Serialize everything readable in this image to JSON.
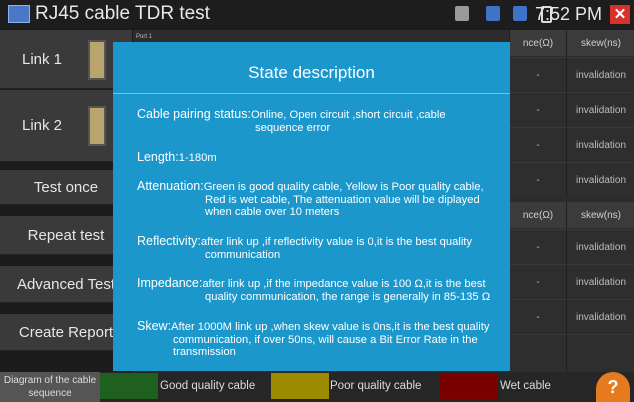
{
  "statusbar": {
    "title": "RJ45 cable TDR test",
    "time": "7:52 PM",
    "close_glyph": "✕"
  },
  "sidebar": {
    "items": [
      {
        "label": "Link 1"
      },
      {
        "label": "Link 2"
      },
      {
        "label": "Test once"
      },
      {
        "label": "Repeat test"
      },
      {
        "label": "Advanced Test"
      },
      {
        "label": "Create Report"
      }
    ]
  },
  "table": {
    "port_label": "Port 1",
    "headers": [
      "nce(Ω)",
      "skew(ns)"
    ],
    "rows": [
      {
        "impedance": "-",
        "skew": "invalidation"
      },
      {
        "impedance": "-",
        "skew": "invalidation"
      },
      {
        "impedance": "-",
        "skew": "invalidation"
      },
      {
        "impedance": "-",
        "skew": "invalidation"
      },
      {
        "impedance": "-",
        "skew": "invalidation"
      },
      {
        "impedance": "-",
        "skew": "invalidation"
      },
      {
        "impedance": "-",
        "skew": "invalidation"
      }
    ]
  },
  "dialog": {
    "title": "State description",
    "items": [
      {
        "label": "Cable pairing status:",
        "body": "Online, Open circuit ,short circuit ,cable",
        "cont": "sequence error"
      },
      {
        "label": "Length:",
        "body": "1-180m",
        "cont": ""
      },
      {
        "label": "Attenuation:",
        "body": "Green is good quality cable, Yellow is Poor quality cable,",
        "cont": "Red is wet cable, The attenuation value will be diplayed when cable over 10 meters"
      },
      {
        "label": "Reflectivity:",
        "body": "after link up ,if reflectivity value is 0,it is the best quality",
        "cont": "communication"
      },
      {
        "label": "Impedance:",
        "body": "after link up ,if the impedance value is 100 Ω,it is the best",
        "cont": "quality communication, the range is generally in 85-135 Ω"
      },
      {
        "label": "Skew:",
        "body": "After 1000M link up ,when skew value is 0ns,it is the best quality",
        "cont": "communication, if over 50ns, will cause a Bit Error Rate in the transmission"
      }
    ]
  },
  "legend": {
    "diagram_label": "Diagram of the cable sequence",
    "good": "Good quality cable",
    "poor": "Poor quality cable",
    "wet": "Wet cable",
    "help_glyph": "?",
    "colors": {
      "good": "#1f5f1f",
      "poor": "#9c8a00",
      "wet": "#7a0000",
      "dialog": "#1c97cc"
    }
  }
}
